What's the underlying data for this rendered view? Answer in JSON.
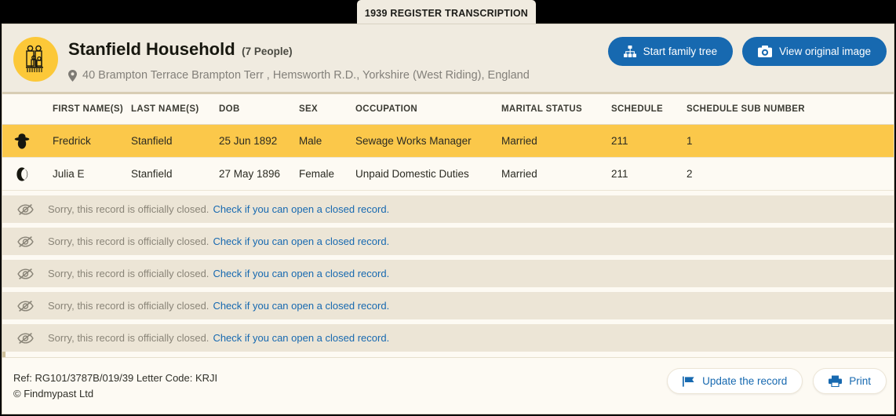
{
  "tab": {
    "label": "1939 REGISTER TRANSCRIPTION"
  },
  "header": {
    "avatar_icon": "family-group-icon",
    "title": "Stanfield Household",
    "people_count": "(7 People)",
    "location_icon": "map-pin-icon",
    "address": "40 Brampton Terrace Brampton Terr , Hemsworth R.D., Yorkshire (West Riding), England",
    "buttons": [
      {
        "label": "Start family tree",
        "icon": "family-tree-icon",
        "color": "#1769b0"
      },
      {
        "label": "View original image",
        "icon": "camera-icon",
        "color": "#1769b0"
      }
    ]
  },
  "table": {
    "columns": [
      "FIRST NAME(S)",
      "LAST NAME(S)",
      "DOB",
      "SEX",
      "OCCUPATION",
      "MARITAL STATUS",
      "SCHEDULE",
      "SCHEDULE SUB NUMBER"
    ],
    "rows": [
      {
        "icon": "male-hat-icon",
        "first_name": "Fredrick",
        "last_name": "Stanfield",
        "dob": "25 Jun 1892",
        "sex": "Male",
        "occupation": "Sewage Works Manager",
        "marital_status": "Married",
        "schedule": "211",
        "schedule_sub_number": "1",
        "highlighted": true
      },
      {
        "icon": "female-hat-icon",
        "first_name": "Julia E",
        "last_name": "Stanfield",
        "dob": "27 May 1896",
        "sex": "Female",
        "occupation": "Unpaid Domestic Duties",
        "marital_status": "Married",
        "schedule": "211",
        "schedule_sub_number": "2",
        "highlighted": false
      }
    ],
    "closed_rows": [
      {
        "icon": "eye-slash-icon",
        "text": "Sorry, this record is officially closed.",
        "link": "Check if you can open a closed record."
      },
      {
        "icon": "eye-slash-icon",
        "text": "Sorry, this record is officially closed.",
        "link": "Check if you can open a closed record."
      },
      {
        "icon": "eye-slash-icon",
        "text": "Sorry, this record is officially closed.",
        "link": "Check if you can open a closed record."
      },
      {
        "icon": "eye-slash-icon",
        "text": "Sorry, this record is officially closed.",
        "link": "Check if you can open a closed record."
      },
      {
        "icon": "eye-slash-icon",
        "text": "Sorry, this record is officially closed.",
        "link": "Check if you can open a closed record."
      }
    ]
  },
  "footer": {
    "reference": "Ref: RG101/3787B/019/39 Letter Code: KRJI",
    "copyright": "© Findmypast Ltd",
    "buttons": [
      {
        "label": "Update the record",
        "icon": "flag-icon"
      },
      {
        "label": "Print",
        "icon": "printer-icon"
      }
    ]
  },
  "colors": {
    "accent_blue": "#1769b0",
    "highlight_yellow": "#fbc84a",
    "header_beige": "#f0ebe0",
    "card_bg": "#fdfaf3",
    "closed_row_bg": "#ece5d6",
    "avatar_yellow": "#fcc838"
  }
}
